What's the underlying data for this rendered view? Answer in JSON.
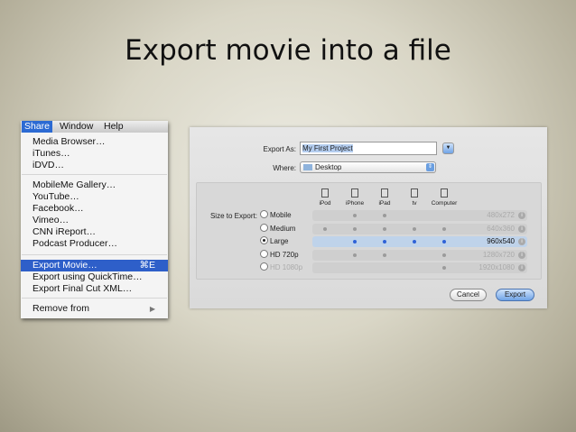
{
  "slide": {
    "title": "Export movie into a file"
  },
  "menubar": {
    "items": [
      "Share",
      "Window",
      "Help"
    ]
  },
  "menu": {
    "groups": [
      [
        "Media Browser…",
        "iTunes…",
        "iDVD…"
      ],
      [
        "MobileMe Gallery…",
        "YouTube…",
        "Facebook…",
        "Vimeo…",
        "CNN iReport…",
        "Podcast Producer…"
      ],
      [
        "Export Movie…",
        "Export using QuickTime…",
        "Export Final Cut XML…"
      ],
      [
        "Remove from"
      ]
    ],
    "shortcut": "⌘E",
    "submenu_arrow": "▶"
  },
  "dialog": {
    "export_as_label": "Export As:",
    "export_as_value": "My First Project",
    "where_label": "Where:",
    "where_value": "Desktop",
    "size_label": "Size to Export:",
    "devices": [
      "iPod",
      "iPhone",
      "iPad",
      "tv",
      "Computer"
    ],
    "sizes": [
      {
        "name": "Mobile",
        "res": "480x272",
        "selected": false,
        "enabled": true,
        "devices": [
          false,
          true,
          true,
          false,
          false
        ]
      },
      {
        "name": "Medium",
        "res": "640x360",
        "selected": false,
        "enabled": true,
        "devices": [
          true,
          true,
          true,
          true,
          true
        ]
      },
      {
        "name": "Large",
        "res": "960x540",
        "selected": true,
        "enabled": true,
        "devices": [
          false,
          true,
          true,
          true,
          true
        ]
      },
      {
        "name": "HD 720p",
        "res": "1280x720",
        "selected": false,
        "enabled": true,
        "devices": [
          false,
          true,
          true,
          false,
          true
        ]
      },
      {
        "name": "HD 1080p",
        "res": "1920x1080",
        "selected": false,
        "enabled": false,
        "devices": [
          false,
          false,
          false,
          false,
          true
        ]
      }
    ],
    "cancel": "Cancel",
    "export": "Export"
  }
}
